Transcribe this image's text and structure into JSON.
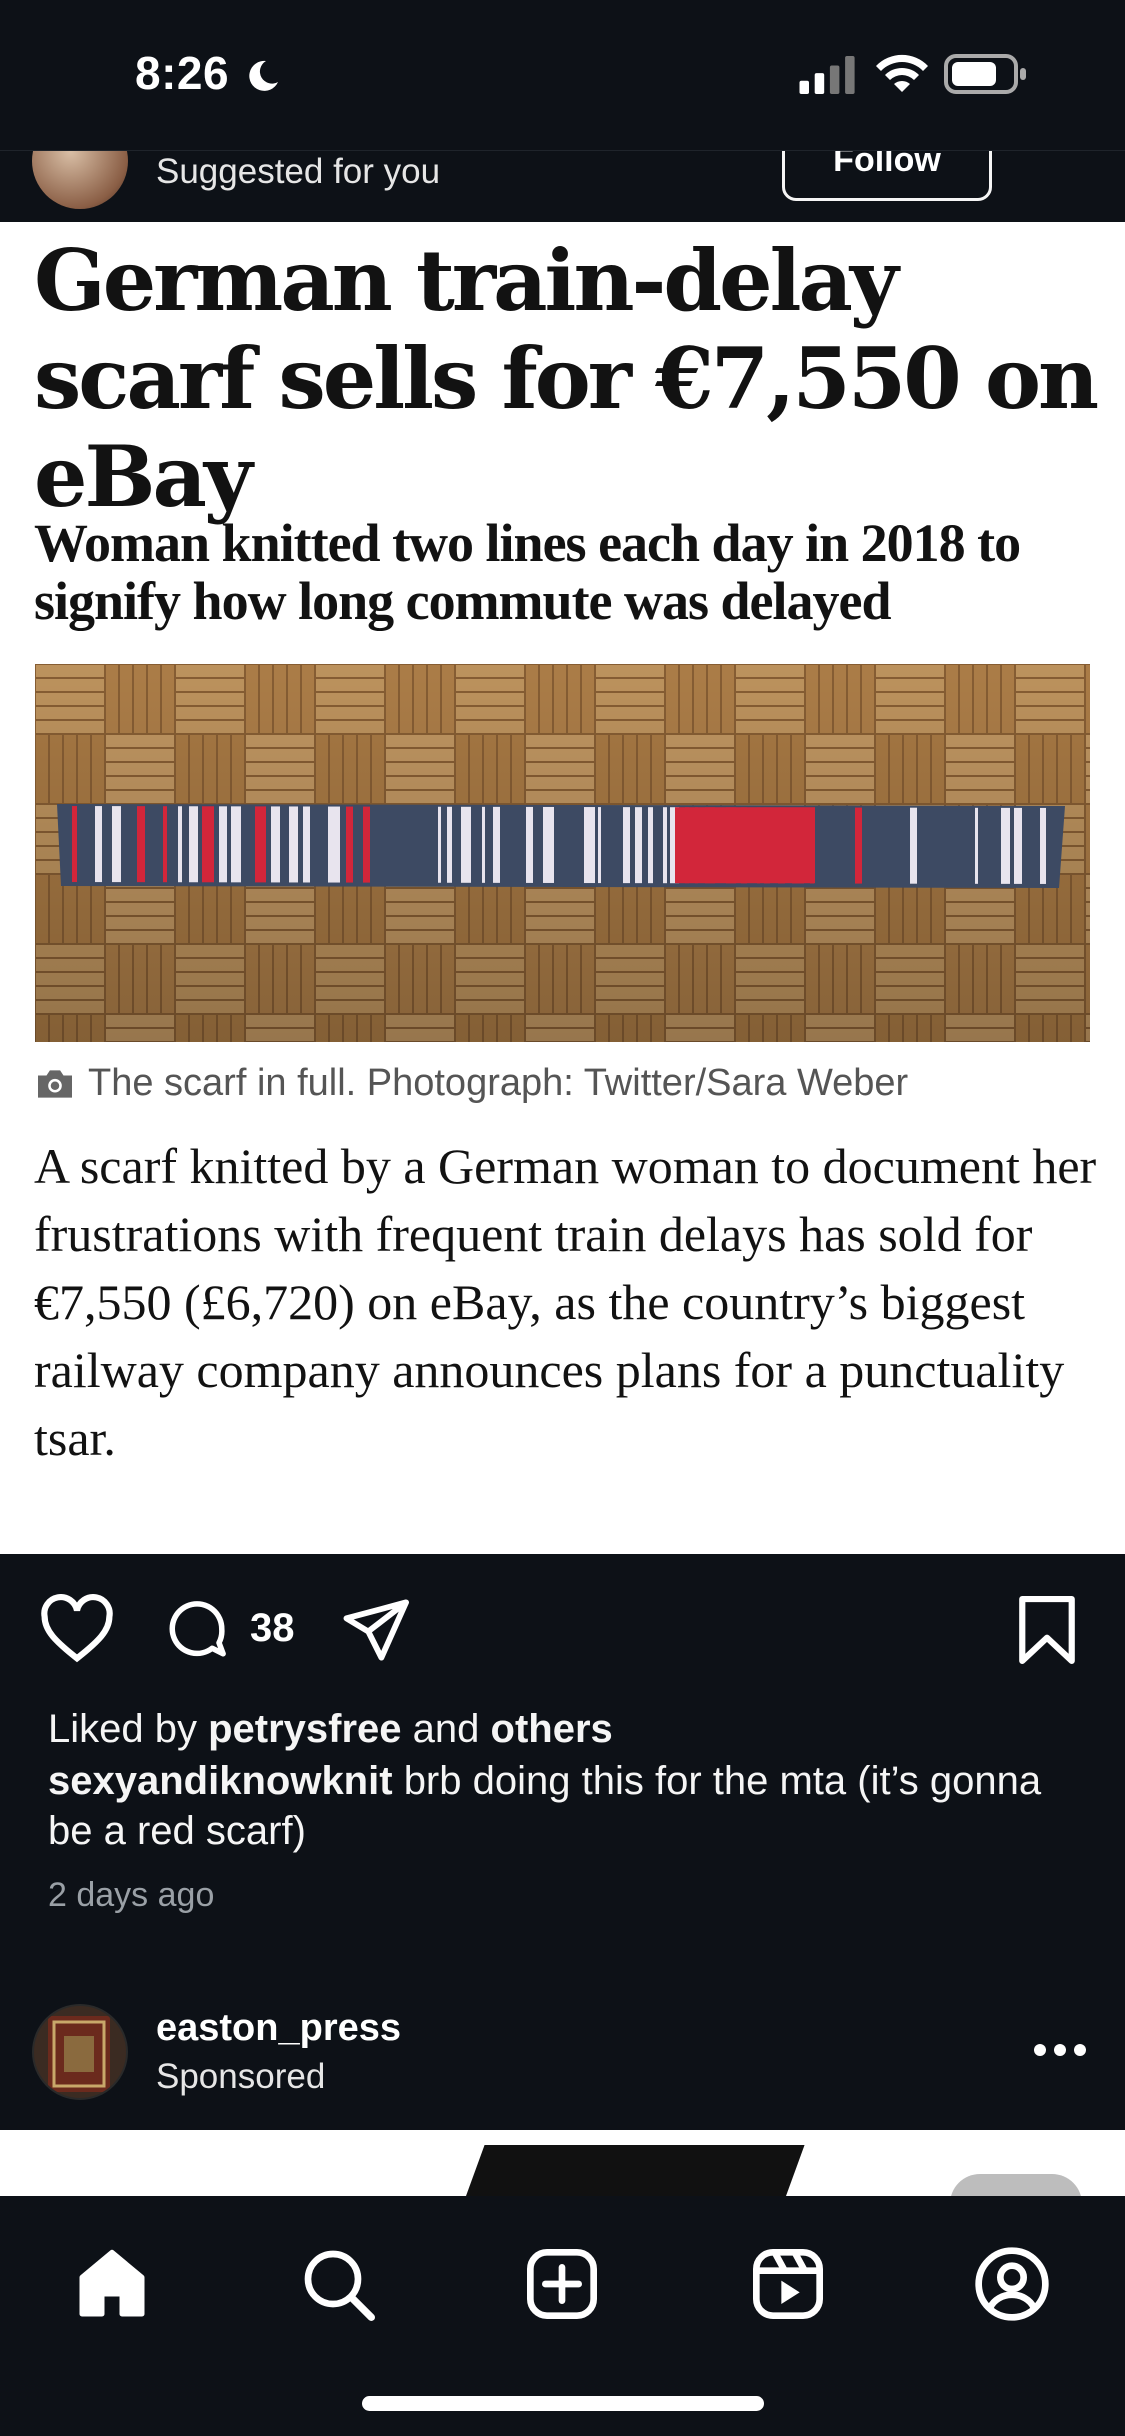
{
  "status_bar": {
    "time": "8:26",
    "icons": [
      "moon-icon",
      "cellular-signal-icon",
      "wifi-icon",
      "battery-icon"
    ]
  },
  "post": {
    "header": {
      "subtitle": "Suggested for you",
      "follow_label": "Follow"
    },
    "article": {
      "headline": "German train-delay scarf sells for €7,550 on eBay",
      "standfirst": "Woman knitted two lines each day in 2018 to signify how long commute was delayed",
      "photo_caption": "The scarf in full. Photograph: Twitter/Sara Weber",
      "body": "A scarf knitted by a German woman to document her frustrations with frequent train delays has sold for €7,550 (£6,720) on eBay, as the country’s biggest railway company announces plans for a punctuality tsar."
    },
    "actions": {
      "comment_count": "38",
      "icons": [
        "heart-icon",
        "comment-icon",
        "share-icon",
        "bookmark-icon"
      ]
    },
    "likes": {
      "prefix": "Liked by",
      "user": "petrysfree",
      "connector": "and",
      "others": "others"
    },
    "caption": {
      "username": "sexyandiknowknit",
      "text": "brb doing this for the mta (it’s gonna be a red scarf)"
    },
    "time_ago": "2 days ago"
  },
  "sponsored_post": {
    "username": "easton_press",
    "label": "Sponsored"
  },
  "tab_bar": {
    "items": [
      "home-icon",
      "search-icon",
      "create-icon",
      "reels-icon",
      "profile-icon"
    ]
  },
  "colors": {
    "background": "#0d1117",
    "text": "#f5f5f5",
    "muted": "#9aa0a6",
    "scarf_navy": "#3d4a63",
    "scarf_red": "#d2263a",
    "scarf_white": "#e8e4ee"
  }
}
